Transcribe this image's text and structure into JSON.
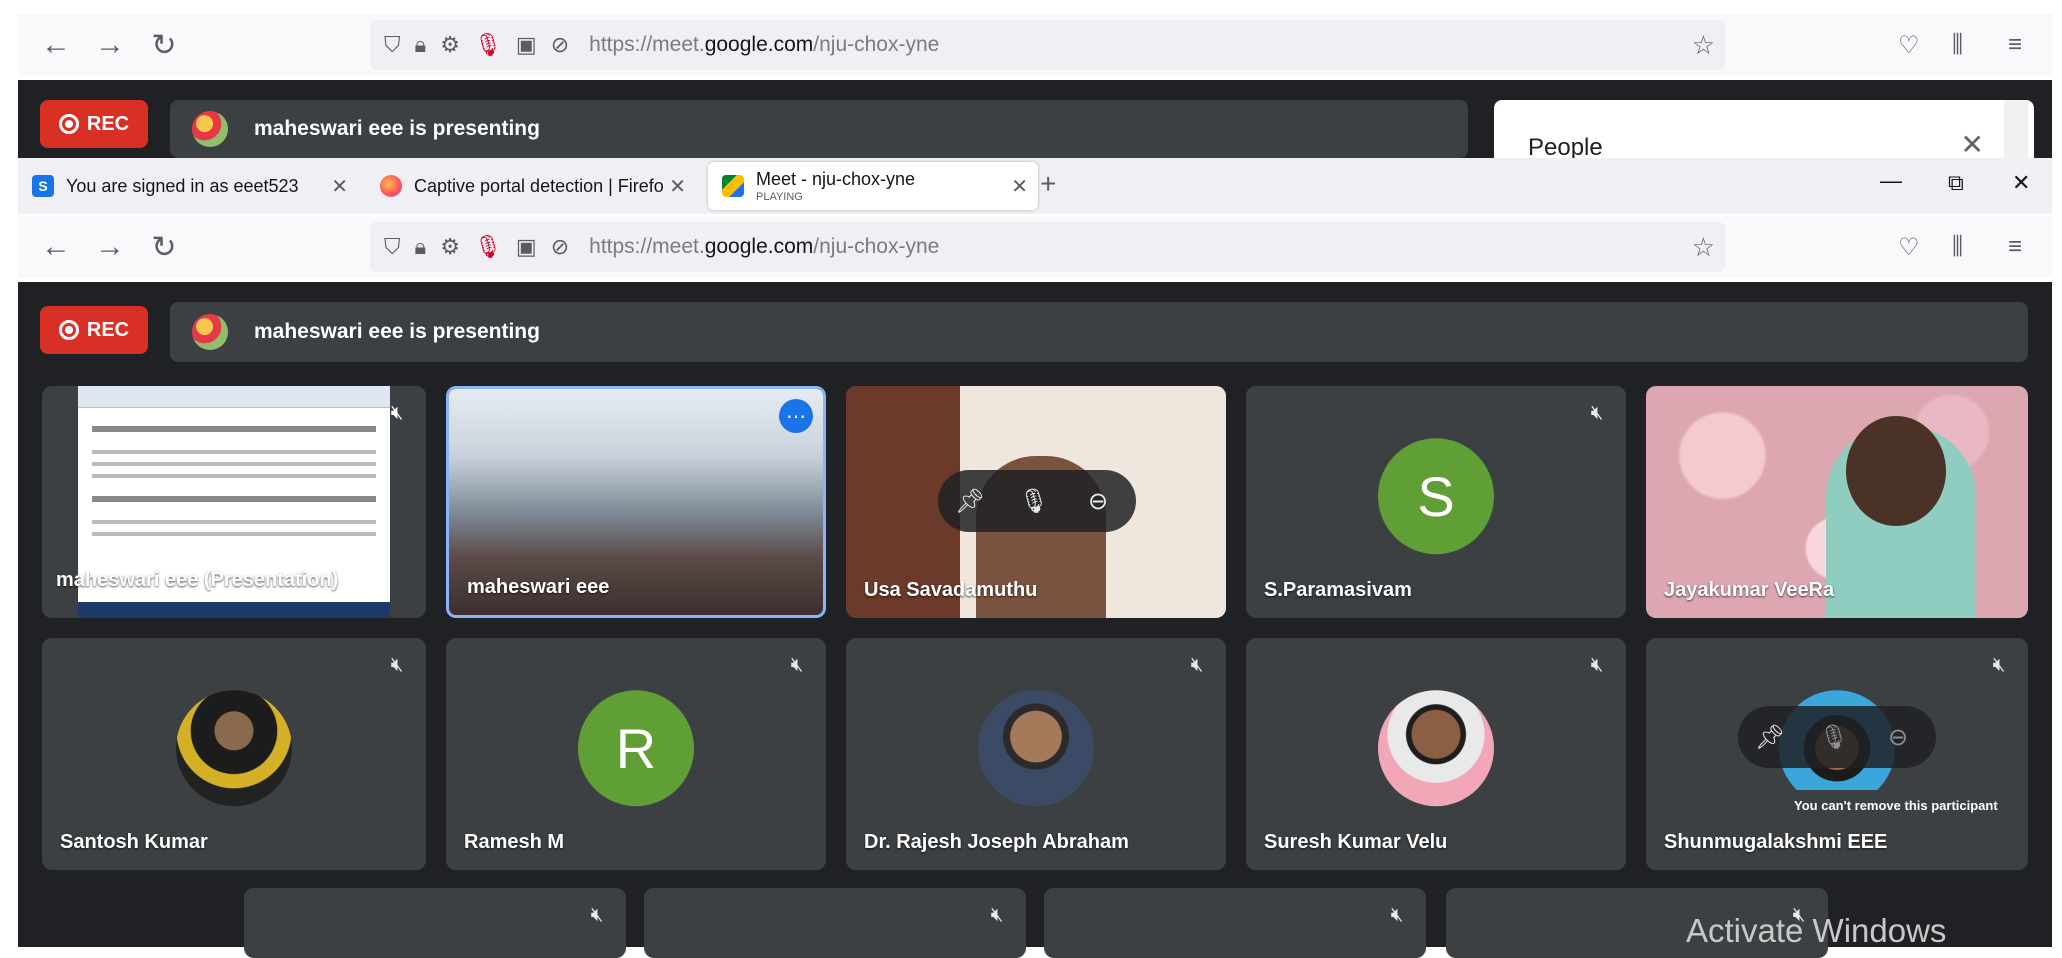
{
  "browser": {
    "tabs": [
      {
        "title": "You are signed in as eeet523",
        "favicon": "S"
      },
      {
        "title": "Captive portal detection | Firefo",
        "favicon": ""
      },
      {
        "title": "Meet - nju-chox-yne",
        "subtitle": "PLAYING",
        "favicon": ""
      }
    ],
    "new_tab": "+",
    "url_prefix": "https://meet.",
    "url_domain": "google.com",
    "url_path": "/nju-chox-yne",
    "window_min": "—",
    "window_max": "⧉",
    "window_close": "✕"
  },
  "meet": {
    "rec_label": "REC",
    "presenting_text": "maheswari eee is presenting",
    "people_title": "People",
    "tooltip": "You can't remove this participant",
    "tiles_row1": [
      {
        "name": "maheswari eee (Presentation)"
      },
      {
        "name": "maheswari eee"
      },
      {
        "name": "Usa Savadamuthu"
      },
      {
        "name": "S.Paramasivam",
        "initial": "S"
      },
      {
        "name": "Jayakumar VeeRa"
      }
    ],
    "tiles_row2": [
      {
        "name": "Santosh Kumar"
      },
      {
        "name": "Ramesh M",
        "initial": "R"
      },
      {
        "name": "Dr. Rajesh Joseph Abraham"
      },
      {
        "name": "Suresh Kumar Velu"
      },
      {
        "name": "Shunmugalakshmi EEE"
      }
    ]
  },
  "watermark": "Activate Windows",
  "colors": {
    "meet_bg": "#202124",
    "tile_bg": "#3c4043",
    "rec_red": "#d93025",
    "avatar_green": "#5f9f35",
    "active_blue": "#8ab4f8"
  }
}
